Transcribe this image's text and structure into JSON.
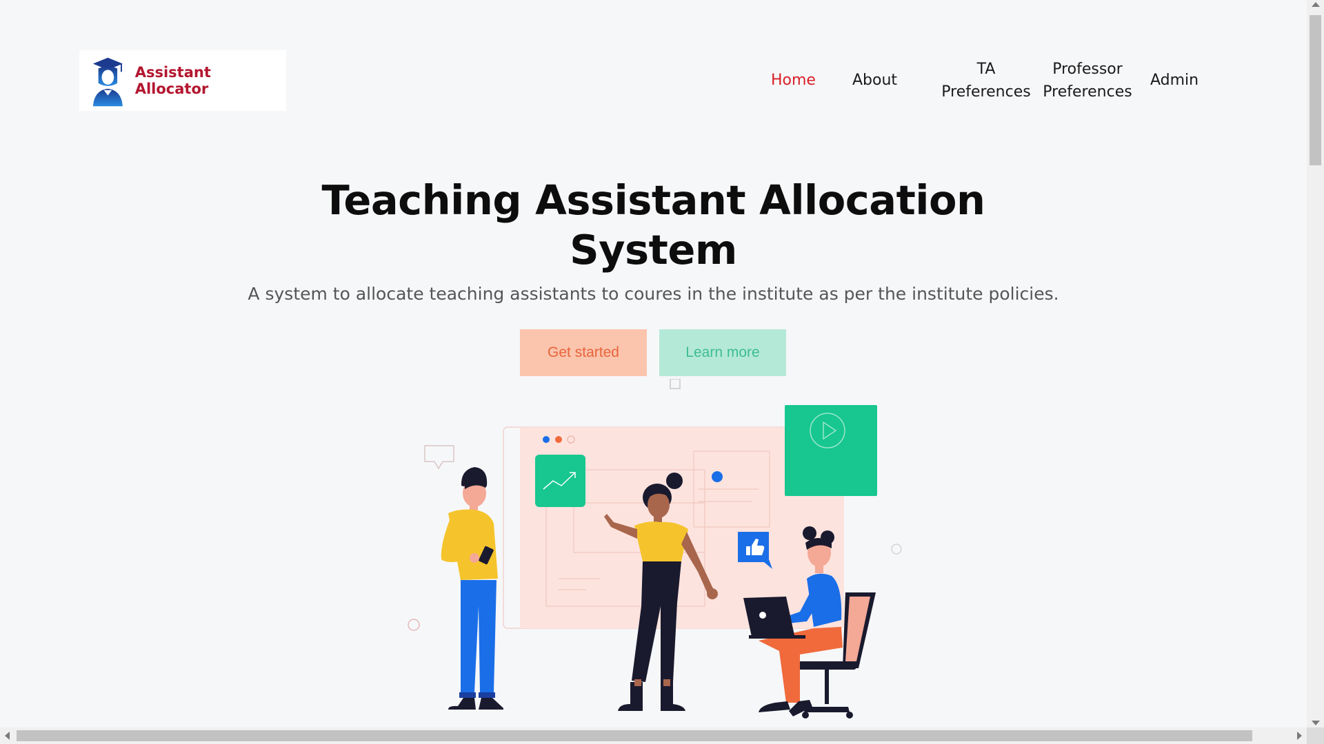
{
  "brand": {
    "name": "Assistant Allocator",
    "logo_icon": "graduate-avatar-icon",
    "name_color": "#b3162f"
  },
  "nav": {
    "items": [
      {
        "label": "Home",
        "active": true
      },
      {
        "label": "About",
        "active": false
      },
      {
        "label_line1": "TA",
        "label_line2": "Preferences",
        "active": false
      },
      {
        "label_line1": "Professor",
        "label_line2": "Preferences",
        "active": false
      },
      {
        "label": "Admin",
        "active": false
      }
    ],
    "active_color": "#d81f26"
  },
  "hero": {
    "title_line1": "Teaching Assistant Allocation",
    "title_line2": "System",
    "subtitle": "A system to allocate teaching assistants to coures in the institute as per the institute policies.",
    "primary_button": "Get started",
    "secondary_button": "Learn more"
  },
  "colors": {
    "background": "#f6f7f9",
    "primary_button_bg": "#fbc4ac",
    "primary_button_text": "#e8643c",
    "secondary_button_bg": "#b5e9d7",
    "secondary_button_text": "#3dbd93",
    "accent_green": "#17c78f",
    "accent_blue": "#1a6ee8",
    "accent_yellow": "#f5c42c"
  },
  "illustration": {
    "icons": [
      "chart-icon",
      "play-icon",
      "thumbs-up-icon",
      "laptop-icon",
      "chat-bubble-icon"
    ]
  }
}
